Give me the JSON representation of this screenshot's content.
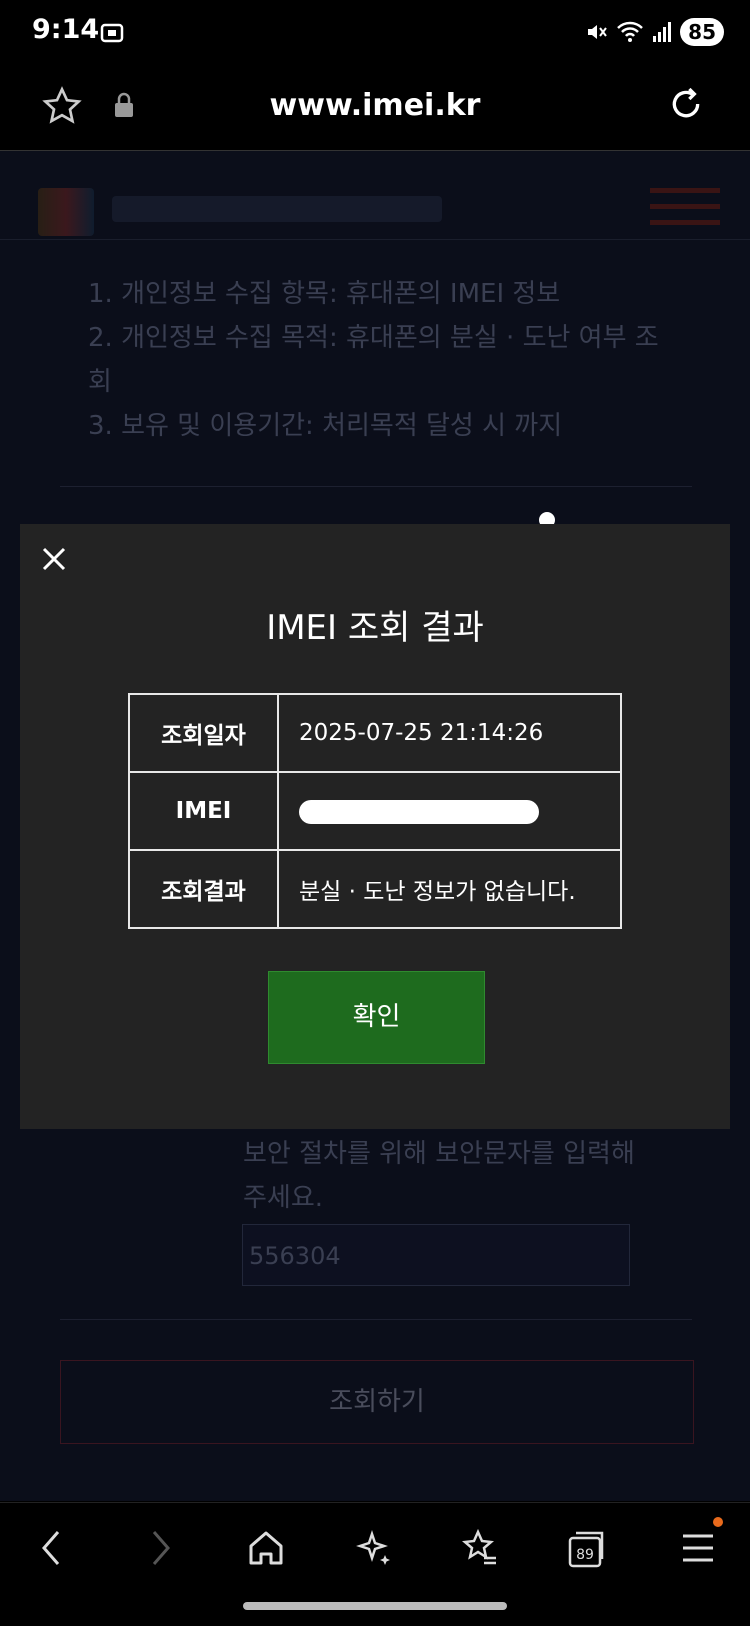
{
  "status_bar": {
    "time": "9:14",
    "battery": "85"
  },
  "browser": {
    "url": "www.imei.kr",
    "tab_count": "89"
  },
  "page": {
    "consent_lines": [
      "1. 개인정보 수집 항목: 휴대폰의 IMEI 정보",
      "2. 개인정보 수집 목적: 휴대폰의 분실 · 도난 여부 조",
      "회",
      "3. 보유 및 이용기간: 처리목적 달성 시 까지"
    ],
    "security_text_1": "보안 절차를 위해 보안문자를 입력해",
    "security_text_2": "주세요.",
    "captcha_value": "556304",
    "lookup_button": "조회하기"
  },
  "modal": {
    "title": "IMEI 조회 결과",
    "rows": [
      {
        "label": "조회일자",
        "value": "2025-07-25 21:14:26"
      },
      {
        "label": "IMEI",
        "value": ""
      },
      {
        "label": "조회결과",
        "value": "분실 · 도난 정보가 없습니다."
      }
    ],
    "confirm_label": "확인"
  },
  "colors": {
    "confirm_bg": "#1e6b1e",
    "modal_bg": "#232323",
    "page_bg": "#0b0e1a"
  }
}
